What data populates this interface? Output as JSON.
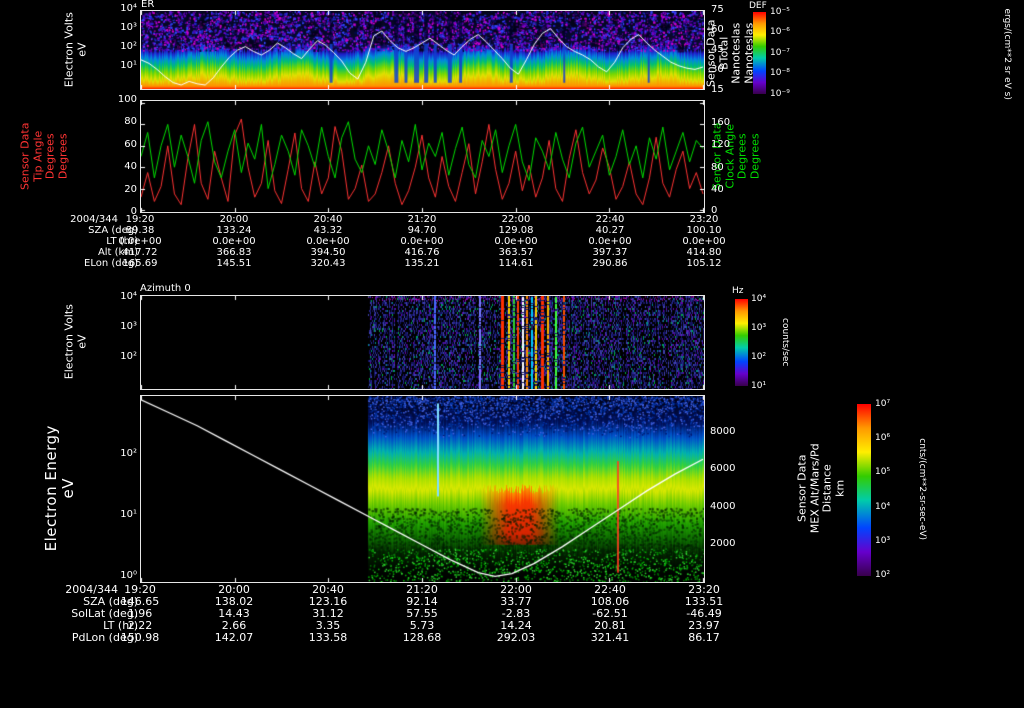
{
  "panel_er": {
    "title": "ER",
    "left_axis": {
      "label_lines": [
        "Electron Volts",
        "eV"
      ],
      "ticks": [
        "10⁴",
        "10³",
        "10²",
        "10¹"
      ]
    },
    "right_axis": {
      "label_lines": [
        "Sensor Data",
        "BTotal",
        "Nanoteslas",
        "Nanoteslas"
      ],
      "ticks": [
        "75",
        "60",
        "45",
        "30",
        "15"
      ]
    },
    "colorbar": {
      "title": "DEF",
      "ticks": [
        "10⁻⁵",
        "10⁻⁶",
        "10⁻⁷",
        "10⁻⁸",
        "10⁻⁹"
      ],
      "units": "ergs/(cm**2 sr eV s)"
    }
  },
  "panel_angles": {
    "left_axis": {
      "label_lines": [
        "Sensor Data",
        "Tip Angle",
        "Degrees",
        "Degrees"
      ],
      "color": "#ff3333",
      "ticks": [
        "100",
        "80",
        "60",
        "40",
        "20",
        "0"
      ]
    },
    "right_axis": {
      "label_lines": [
        "Sensor Data",
        "Clock Angle",
        "Degrees",
        "Degrees"
      ],
      "color": "#00dd00",
      "ticks": [
        "160",
        "120",
        "80",
        "40",
        "0"
      ]
    }
  },
  "table_top": {
    "date": "2004/344",
    "times": [
      "19:20",
      "20:00",
      "20:40",
      "21:20",
      "22:00",
      "22:40",
      "23:20"
    ],
    "rows": [
      {
        "label": "SZA (deg)",
        "values": [
          "89.38",
          "133.24",
          "43.32",
          "94.70",
          "129.08",
          "40.27",
          "100.10"
        ]
      },
      {
        "label": "LT (hr)",
        "values": [
          "0.0e+00",
          "0.0e+00",
          "0.0e+00",
          "0.0e+00",
          "0.0e+00",
          "0.0e+00",
          "0.0e+00"
        ]
      },
      {
        "label": "Alt (km)",
        "values": [
          "417.72",
          "366.83",
          "394.50",
          "416.76",
          "363.57",
          "397.37",
          "414.80"
        ]
      },
      {
        "label": "ELon (deg)",
        "values": [
          "165.69",
          "145.51",
          "320.43",
          "135.21",
          "114.61",
          "290.86",
          "105.12"
        ]
      }
    ]
  },
  "panel_az": {
    "title": "Azimuth 0",
    "left_axis": {
      "label_lines": [
        "Electron Volts",
        "eV"
      ],
      "ticks": [
        "10⁴",
        "10³",
        "10²"
      ]
    },
    "colorbar": {
      "title": "Hz",
      "ticks": [
        "10⁴",
        "10³",
        "10²",
        "10¹"
      ],
      "units": "counts/sec"
    }
  },
  "panel_energy": {
    "left_axis": {
      "label_lines": [
        "Electron Energy",
        "eV"
      ],
      "ticks": [
        "10²",
        "10¹",
        "10⁰"
      ]
    },
    "right_axis": {
      "label_lines": [
        "Sensor Data",
        "MEX Alt/Mars/Pd",
        "Distance",
        "km"
      ],
      "ticks": [
        "8000",
        "6000",
        "4000",
        "2000"
      ]
    },
    "colorbar": {
      "ticks": [
        "10⁷",
        "10⁶",
        "10⁵",
        "10⁴",
        "10³",
        "10²"
      ],
      "units": "cnts/(cm**2-sr-sec-eV)"
    }
  },
  "table_bottom": {
    "date": "2004/344",
    "times": [
      "19:20",
      "20:00",
      "20:40",
      "21:20",
      "22:00",
      "22:40",
      "23:20"
    ],
    "rows": [
      {
        "label": "SZA (deg)",
        "values": [
          "146.65",
          "138.02",
          "123.16",
          "92.14",
          "33.77",
          "108.06",
          "133.51"
        ]
      },
      {
        "label": "SolLat (deg)",
        "values": [
          "1.96",
          "14.43",
          "31.12",
          "57.55",
          "-2.83",
          "-62.51",
          "-46.49"
        ]
      },
      {
        "label": "LT (hr)",
        "values": [
          "2.22",
          "2.66",
          "3.35",
          "5.73",
          "14.24",
          "20.81",
          "23.97"
        ]
      },
      {
        "label": "PdLon (deg)",
        "values": [
          "150.98",
          "142.07",
          "133.58",
          "128.68",
          "292.03",
          "321.41",
          "86.17"
        ]
      }
    ]
  },
  "chart_data": [
    {
      "id": "er_spectrogram",
      "type": "heatmap",
      "title": "ER",
      "x_ticks": [
        "19:20",
        "20:00",
        "20:40",
        "21:20",
        "22:00",
        "22:40",
        "23:20"
      ],
      "y_axis": {
        "label": "Electron Volts eV",
        "scale": "log",
        "ticks": [
          "10⁴",
          "10³",
          "10²",
          "10¹"
        ]
      },
      "value_axis": {
        "label": "DEF ergs/(cm**2 sr eV s)",
        "ticks": [
          "10⁻⁵",
          "10⁻⁶",
          "10⁻⁷",
          "10⁻⁸",
          "10⁻⁹"
        ]
      },
      "pattern": "high electron flux band (green-yellow-red) below ~100 eV across whole interval; blue/purple low-flux speckle at high energies; deep blue dropout columns near 21:30-22:00",
      "overlay": {
        "name": "BTotal (nT)",
        "axis_range": [
          15,
          75
        ],
        "values": [
          36,
          33,
          28,
          22,
          17,
          15,
          18,
          16,
          15,
          21,
          30,
          38,
          44,
          47,
          43,
          40,
          44,
          50,
          46,
          41,
          37,
          45,
          52,
          48,
          42,
          35,
          25,
          20,
          34,
          56,
          60,
          52,
          46,
          43,
          46,
          50,
          54,
          49,
          44,
          40,
          47,
          53,
          57,
          51,
          44,
          37,
          29,
          24,
          36,
          49,
          58,
          62,
          54,
          47,
          43,
          40,
          36,
          30,
          26,
          34,
          46,
          53,
          57,
          50,
          44,
          39,
          34,
          31,
          29,
          28,
          30
        ]
      }
    },
    {
      "id": "angle_lines",
      "type": "line",
      "x_ticks": [
        "19:20",
        "20:00",
        "20:40",
        "21:20",
        "22:00",
        "22:40",
        "23:20"
      ],
      "series": [
        {
          "name": "Tip Angle (deg)",
          "color": "#ff3333",
          "axis_range": [
            0,
            100
          ],
          "values": [
            12,
            35,
            8,
            22,
            60,
            15,
            5,
            48,
            80,
            25,
            10,
            55,
            30,
            8,
            70,
            85,
            40,
            12,
            25,
            65,
            18,
            6,
            38,
            72,
            20,
            8,
            45,
            15,
            30,
            78,
            55,
            10,
            20,
            42,
            8,
            15,
            35,
            60,
            25,
            5,
            18,
            40,
            70,
            30,
            12,
            50,
            22,
            8,
            35,
            62,
            15,
            45,
            80,
            38,
            10,
            25,
            55,
            18,
            42,
            12,
            30,
            65,
            20,
            8,
            48,
            75,
            35,
            15,
            28,
            58,
            40,
            10,
            22,
            45,
            15,
            5,
            30,
            68,
            25,
            12,
            38,
            55,
            20,
            35,
            15
          ]
        },
        {
          "name": "Clock Angle (deg)",
          "color": "#00dd00",
          "axis_range": [
            0,
            200
          ],
          "values": [
            100,
            145,
            60,
            120,
            160,
            80,
            140,
            100,
            50,
            130,
            165,
            90,
            60,
            110,
            150,
            70,
            125,
            95,
            160,
            40,
            85,
            140,
            110,
            65,
            150,
            120,
            80,
            155,
            100,
            60,
            135,
            165,
            95,
            70,
            120,
            85,
            150,
            110,
            60,
            130,
            90,
            160,
            75,
            125,
            100,
            145,
            65,
            115,
            155,
            85,
            60,
            130,
            100,
            150,
            70,
            120,
            160,
            90,
            55,
            135,
            110,
            75,
            145,
            95,
            60,
            125,
            155,
            80,
            110,
            140,
            65,
            100,
            150,
            85,
            120,
            60,
            135,
            95,
            155,
            75,
            110,
            145,
            90,
            130,
            115
          ]
        }
      ]
    },
    {
      "id": "azimuth_spectrogram",
      "type": "heatmap",
      "title": "Azimuth 0",
      "data_start_frac": 0.403,
      "y_axis": {
        "label": "Electron Volts eV",
        "scale": "log",
        "ticks": [
          "10⁴",
          "10³",
          "10²"
        ]
      },
      "value_axis": {
        "label": "Hz counts/sec",
        "ticks": [
          "10⁴",
          "10³",
          "10²",
          "10¹"
        ]
      },
      "pattern": "no data before ~20:55; sparse blue/purple count-rate speckle afterwards with bright multicolour vertical stripes around 22:00-22:20"
    },
    {
      "id": "energy_spectrogram",
      "type": "heatmap",
      "data_start_frac": 0.403,
      "y_axis": {
        "label": "Electron Energy eV",
        "scale": "log",
        "ticks": [
          "10²",
          "10¹",
          "10⁰"
        ]
      },
      "value_axis": {
        "label": "cnts/(cm**2-sr-sec-eV)",
        "ticks": [
          "10⁷",
          "10⁶",
          "10⁵",
          "10⁴",
          "10³",
          "10²"
        ]
      },
      "pattern": "no data before ~20:55; broad green-yellow flux band ~5-100 eV; intense red enhancement ~21:45-22:10 below ~30 eV; blue speckle at high energies; sparse green speckle at lowest energies",
      "overlay": {
        "name": "MEX Alt/Mars/Pd Distance (km)",
        "axis_range": [
          0,
          10000
        ],
        "x_frac": [
          0,
          0.05,
          0.1,
          0.15,
          0.2,
          0.25,
          0.3,
          0.35,
          0.4,
          0.45,
          0.5,
          0.55,
          0.6,
          0.63,
          0.66,
          0.7,
          0.75,
          0.8,
          0.85,
          0.9,
          0.95,
          1
        ],
        "values": [
          9800,
          9100,
          8400,
          7600,
          6800,
          6000,
          5200,
          4400,
          3600,
          2800,
          2000,
          1200,
          500,
          300,
          450,
          1000,
          1900,
          2900,
          3900,
          4900,
          5800,
          6600
        ]
      }
    }
  ]
}
